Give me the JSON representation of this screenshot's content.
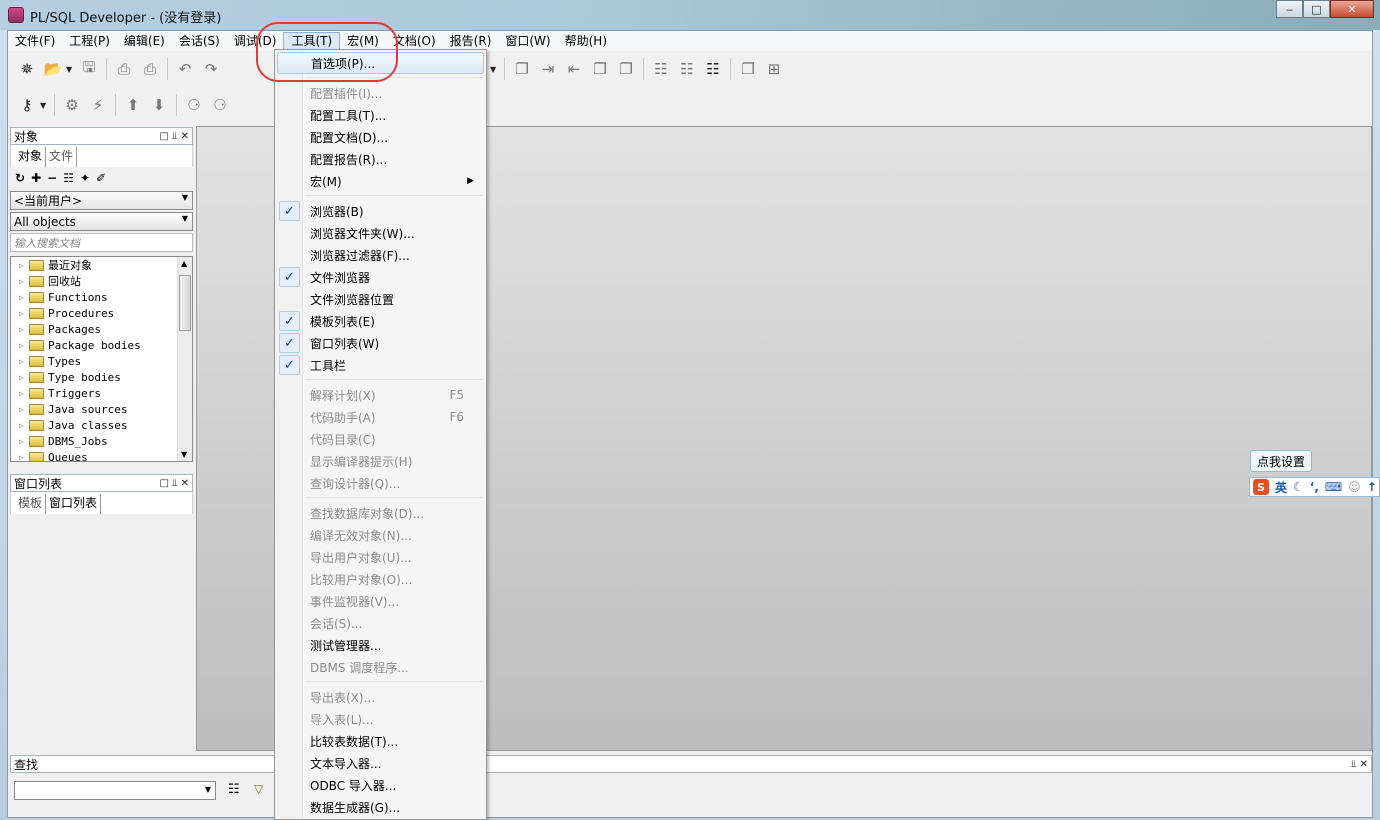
{
  "window": {
    "title": "PL/SQL Developer - (没有登录)"
  },
  "menubar": [
    "文件(F)",
    "工程(P)",
    "编辑(E)",
    "会话(S)",
    "调试(D)",
    "工具(T)",
    "宏(M)",
    "文档(O)",
    "报告(R)",
    "窗口(W)",
    "帮助(H)"
  ],
  "active_menu": "工具(T)",
  "object_panel": {
    "title": "对象",
    "tabs": [
      "对象",
      "文件"
    ],
    "user_combo": "<当前用户>",
    "type_combo": "All objects",
    "filter_placeholder": "输入搜索文档",
    "tree_items": [
      "最近对象",
      "回收站",
      "Functions",
      "Procedures",
      "Packages",
      "Package bodies",
      "Types",
      "Type bodies",
      "Triggers",
      "Java sources",
      "Java classes",
      "DBMS_Jobs",
      "Queues"
    ]
  },
  "window_list_panel": {
    "title": "窗口列表",
    "tabs": [
      "模板",
      "窗口列表"
    ]
  },
  "find_panel": {
    "title": "查找"
  },
  "tools_menu": [
    {
      "label": "首选项(P)...",
      "state": "highlighted"
    },
    {
      "sep": true
    },
    {
      "label": "配置插件(I)...",
      "state": "disabled"
    },
    {
      "label": "配置工具(T)..."
    },
    {
      "label": "配置文档(D)..."
    },
    {
      "label": "配置报告(R)..."
    },
    {
      "label": "宏(M)",
      "submenu": true
    },
    {
      "sep": true
    },
    {
      "label": "浏览器(B)",
      "checked": true
    },
    {
      "label": "浏览器文件夹(W)..."
    },
    {
      "label": "浏览器过滤器(F)..."
    },
    {
      "label": "文件浏览器",
      "checked": true
    },
    {
      "label": "文件浏览器位置"
    },
    {
      "label": "模板列表(E)",
      "checked": true
    },
    {
      "label": "窗口列表(W)",
      "checked": true
    },
    {
      "label": "工具栏",
      "checked": true
    },
    {
      "sep": true
    },
    {
      "label": "解释计划(X)",
      "state": "disabled",
      "shortcut": "F5"
    },
    {
      "label": "代码助手(A)",
      "state": "disabled",
      "shortcut": "F6"
    },
    {
      "label": "代码目录(C)",
      "state": "disabled"
    },
    {
      "label": "显示编译器提示(H)",
      "state": "disabled"
    },
    {
      "label": "查询设计器(Q)...",
      "state": "disabled"
    },
    {
      "sep": true
    },
    {
      "label": "查找数据库对象(D)...",
      "state": "disabled"
    },
    {
      "label": "编译无效对象(N)...",
      "state": "disabled"
    },
    {
      "label": "导出用户对象(U)...",
      "state": "disabled"
    },
    {
      "label": "比较用户对象(O)...",
      "state": "disabled"
    },
    {
      "label": "事件监视器(V)...",
      "state": "disabled"
    },
    {
      "label": "会话(S)...",
      "state": "disabled"
    },
    {
      "label": "测试管理器..."
    },
    {
      "label": "DBMS 调度程序...",
      "state": "disabled"
    },
    {
      "sep": true
    },
    {
      "label": "导出表(X)...",
      "state": "disabled"
    },
    {
      "label": "导入表(L)...",
      "state": "disabled"
    },
    {
      "label": "比较表数据(T)..."
    },
    {
      "label": "文本导入器..."
    },
    {
      "label": "ODBC 导入器..."
    },
    {
      "label": "数据生成器(G)..."
    }
  ],
  "ime": {
    "tip": "点我设置",
    "mode": "英"
  },
  "colors": {
    "highlight_circle": "#e23a3a",
    "menu_bg": "#f5f5f5",
    "check_blue": "#1a3f8a"
  }
}
